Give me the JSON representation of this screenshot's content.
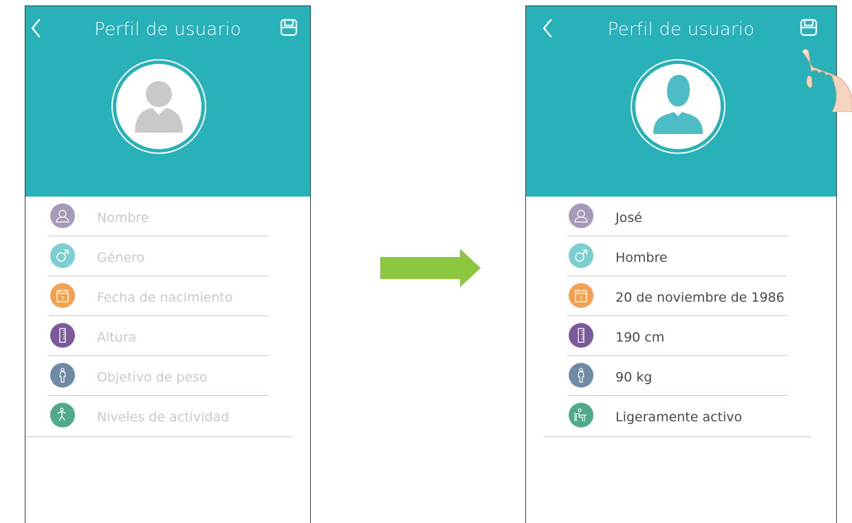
{
  "before": {
    "title": "Perfil de usuario",
    "fields": [
      {
        "label": "Nombre",
        "icon": "person-icon",
        "color": "#a79ab9"
      },
      {
        "label": "Género",
        "icon": "male-icon",
        "color": "#7ccfd0"
      },
      {
        "label": "Fecha de nacimiento",
        "icon": "calendar-icon",
        "color": "#f4a14f"
      },
      {
        "label": "Altura",
        "icon": "ruler-icon",
        "color": "#7a5a99"
      },
      {
        "label": "Objetivo de peso",
        "icon": "body-icon",
        "color": "#6f8aa5"
      },
      {
        "label": "Niveles de actividad",
        "icon": "running-icon",
        "color": "#4fa98d"
      }
    ]
  },
  "after": {
    "title": "Perfil de usuario",
    "fields": [
      {
        "label": "José",
        "icon": "person-icon",
        "color": "#a79ab9"
      },
      {
        "label": "Hombre",
        "icon": "male-icon",
        "color": "#7ccfd0"
      },
      {
        "label": "20 de noviembre de 1986",
        "icon": "calendar-icon",
        "color": "#f4a14f"
      },
      {
        "label": "190 cm",
        "icon": "ruler-icon",
        "color": "#7a5a99"
      },
      {
        "label": "90 kg",
        "icon": "body-icon",
        "color": "#6f8aa5"
      },
      {
        "label": "Ligeramente activo",
        "icon": "desk-icon",
        "color": "#4fa98d"
      }
    ]
  },
  "colors": {
    "header": "#28b1b9",
    "arrow": "#8dc63f",
    "avatar_empty": "#c9c9c9",
    "avatar_filled": "#4dbcc4"
  }
}
